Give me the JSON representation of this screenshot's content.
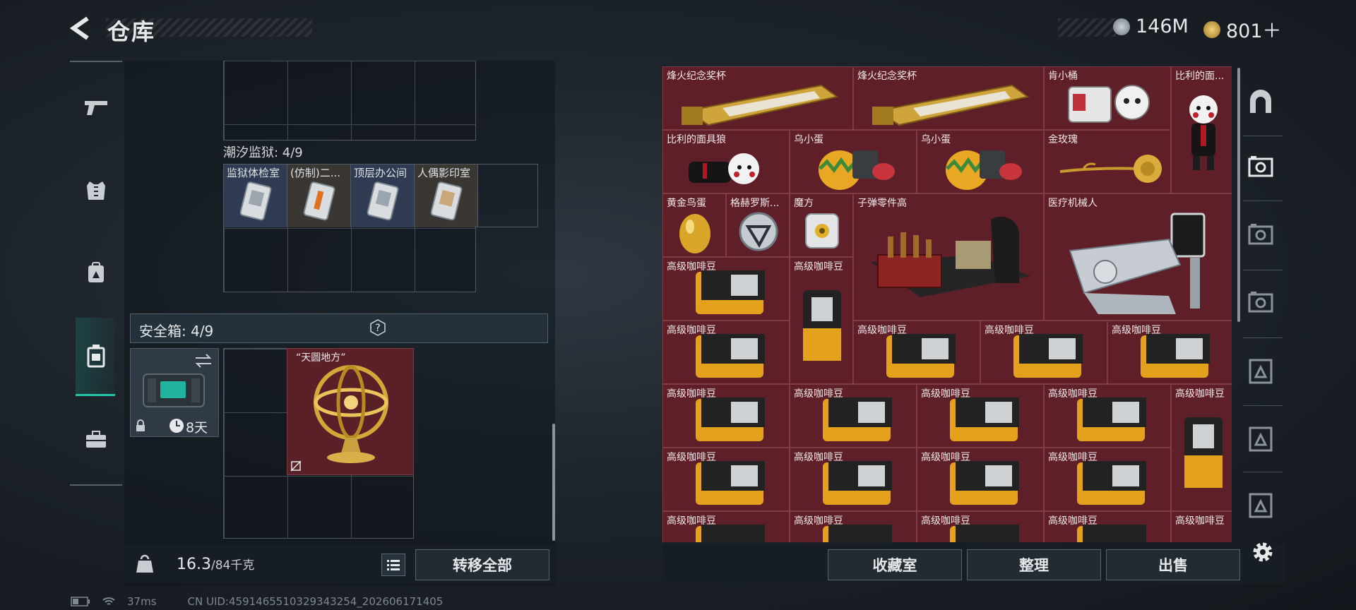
{
  "header": {
    "title": "仓库",
    "currency_silver": "146M",
    "currency_gold": "801＋"
  },
  "left": {
    "prison_label": "潮汐监狱: 4/9",
    "keys": [
      "监狱体检室",
      "(仿制)二...",
      "顶层办公间",
      "人偶影印室"
    ],
    "safe_label": "安全箱: 4/9",
    "safe_help": "?",
    "safe_days": "8天",
    "tianyuan_label": "“天圆地方”",
    "weight_value": "16.3",
    "weight_max": "/84千克",
    "transfer_all": "转移全部"
  },
  "stash": {
    "items": [
      "烽火纪念奖杯",
      "烽火纪念奖杯",
      "肯小桶",
      "比利的面...",
      "比利的面具狼",
      "乌小蛋",
      "乌小蛋",
      "金玫瑰",
      "黄金鸟蛋",
      "格赫罗斯...",
      "魔方",
      "子弹零件高",
      "医疗机械人",
      "高级咖啡豆"
    ],
    "buttons": {
      "collection": "收藏室",
      "organize": "整理",
      "sell": "出售"
    }
  },
  "status": {
    "ping": "37ms",
    "uid": "CN UID:4591465510329343254_202606171405"
  },
  "colors": {
    "accent": "#24c4a8",
    "stash_bg": "#5b1c25",
    "gold": "#d4a838"
  }
}
